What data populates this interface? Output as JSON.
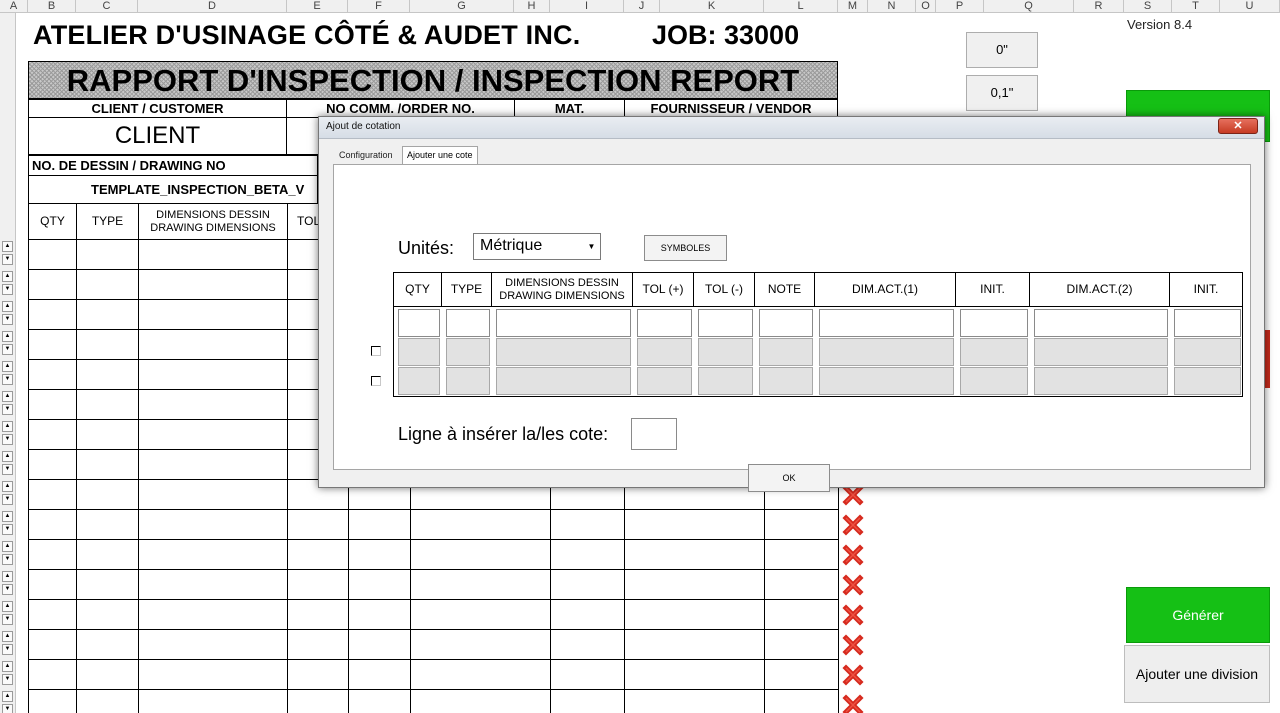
{
  "sheet": {
    "columns": [
      "A",
      "B",
      "C",
      "D",
      "E",
      "F",
      "G",
      "H",
      "I",
      "J",
      "K",
      "L",
      "M",
      "N",
      "O",
      "P",
      "Q",
      "R",
      "S",
      "T",
      "U"
    ],
    "company_title": "ATELIER D'USINAGE CÔTÉ & AUDET INC.",
    "job_label": "JOB: 33000",
    "report_title": "RAPPORT D'INSPECTION / INSPECTION REPORT",
    "client_header": "CLIENT / CUSTOMER",
    "order_header": "NO COMM. /ORDER NO.",
    "mat_header": "MAT.",
    "vendor_header": "FOURNISSEUR / VENDOR",
    "client_value": "CLIENT",
    "drawing_header": "NO. DE DESSIN / DRAWING NO",
    "drawing_value": "TEMPLATE_INSPECTION_BETA_V",
    "table_headers": {
      "qty": "QTY",
      "type": "TYPE",
      "dimensions": "DIMENSIONS DESSIN DRAWING DIMENSIONS",
      "tol": "TOL"
    },
    "version": "Version 8.4",
    "side_buttons": {
      "zero": "0\"",
      "zero_one": "0,1\""
    },
    "generate_button": "Générer",
    "add_division_button": "Ajouter une division"
  },
  "dialog": {
    "title": "Ajout de cotation",
    "close_label": "✕",
    "tabs": [
      "Configuration",
      "Ajouter une cote"
    ],
    "active_tab": "Ajouter une cote",
    "units_label": "Unités:",
    "units_value": "Métrique",
    "symbols_button": "SYMBOLES",
    "grid_headers": [
      "QTY",
      "TYPE",
      "DIMENSIONS DESSIN DRAWING DIMENSIONS",
      "TOL (+)",
      "TOL (-)",
      "NOTE",
      "DIM.ACT.(1)",
      "INIT.",
      "DIM.ACT.(2)",
      "INIT."
    ],
    "insert_line_label": "Ligne à insérer la/les cote:",
    "insert_line_value": "",
    "ok_button": "OK"
  },
  "colors": {
    "green_button": "#15c015",
    "delete_icon": "#d62a1e"
  }
}
